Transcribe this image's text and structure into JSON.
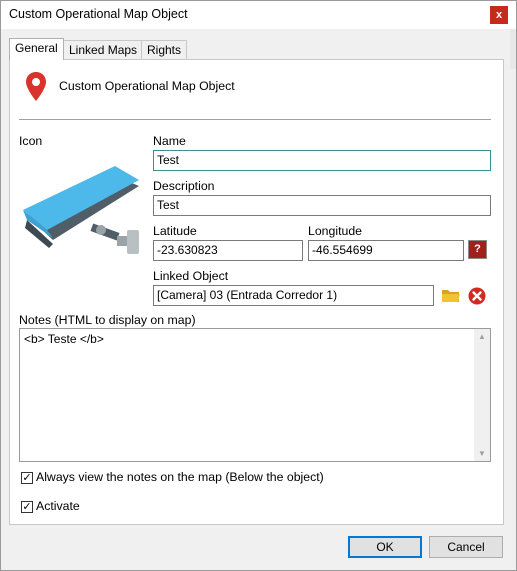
{
  "window": {
    "title": "Custom Operational Map Object",
    "close_glyph": "x"
  },
  "tabs": [
    {
      "label": "General",
      "active": true
    },
    {
      "label": "Linked Maps",
      "active": false
    },
    {
      "label": "Rights",
      "active": false
    }
  ],
  "header": {
    "icon": "map-pin-icon",
    "title": "Custom Operational Map Object"
  },
  "icon_section": {
    "label": "Icon",
    "image": "security-camera-icon"
  },
  "form": {
    "name_label": "Name",
    "name_value": "Test",
    "description_label": "Description",
    "description_value": "Test",
    "latitude_label": "Latitude",
    "latitude_value": "-23.630823",
    "longitude_label": "Longitude",
    "longitude_value": "-46.554699",
    "coord_button_glyph": "?",
    "linked_object_label": "Linked Object",
    "linked_object_value": "[Camera] 03 (Entrada Corredor 1)",
    "notes_label": "Notes (HTML to display on map)",
    "notes_value": "<b> Teste </b>"
  },
  "options": {
    "always_view_label": "Always view the notes on the map (Below the object)",
    "always_view_checked": true,
    "activate_label": "Activate",
    "activate_checked": true
  },
  "buttons": {
    "ok": "OK",
    "cancel": "Cancel"
  },
  "colors": {
    "pin": "#d9342b",
    "camera_body": "#4db8ea",
    "camera_dark": "#4f5e68",
    "close": "#c42b1c",
    "ok_border": "#0078d7"
  }
}
